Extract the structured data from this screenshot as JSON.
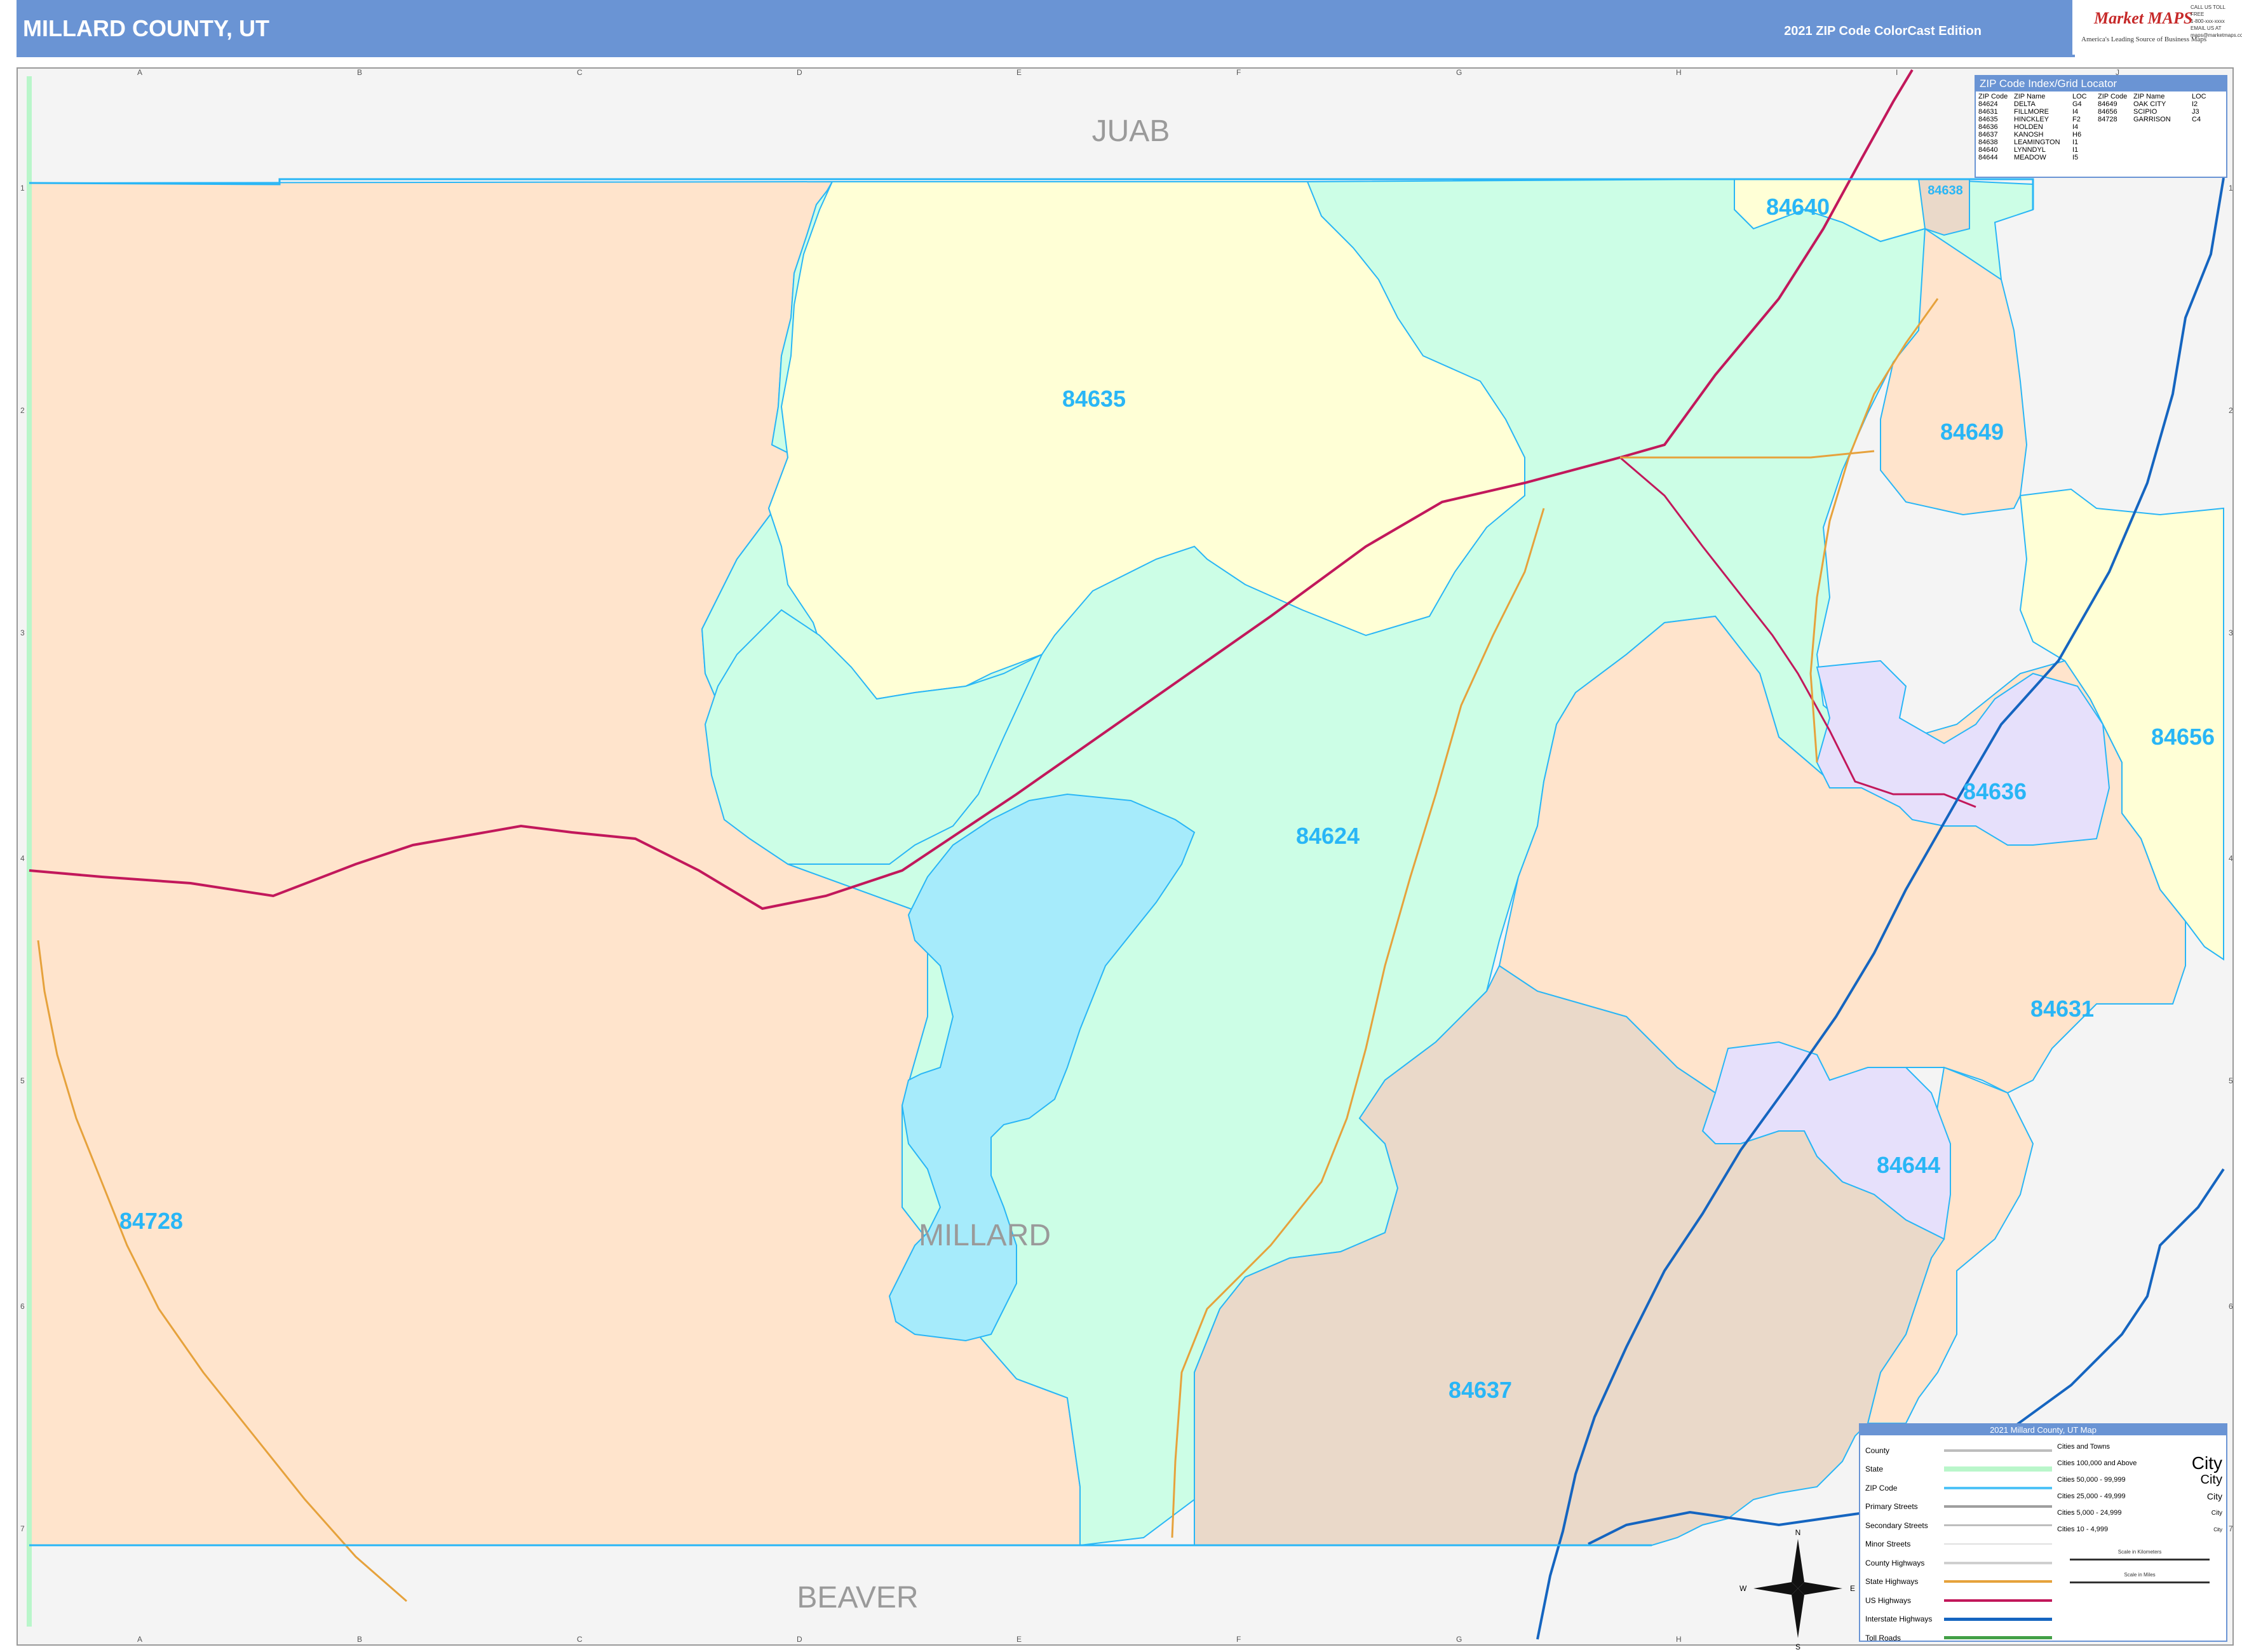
{
  "header": {
    "title": "MILLARD COUNTY, UT",
    "edition": "2021 ZIP Code ColorCast Edition"
  },
  "logo": {
    "brand": "Market MAPS",
    "tagline": "America's Leading Source of Business Maps",
    "contact": [
      "CALL US TOLL FREE",
      "1-800-xxx-xxxx",
      "EMAIL US AT",
      "maps@marketmaps.com"
    ]
  },
  "county_labels": {
    "north": "JUAB",
    "center": "MILLARD",
    "south": "BEAVER"
  },
  "zip_labels": [
    "84640",
    "84638",
    "84635",
    "84649",
    "84656",
    "84636",
    "84624",
    "84631",
    "84644",
    "84728",
    "84637"
  ],
  "grid": {
    "columns": [
      "A",
      "B",
      "C",
      "D",
      "E",
      "F",
      "G",
      "H",
      "I",
      "J"
    ],
    "rows": [
      "1",
      "2",
      "3",
      "4",
      "5",
      "6",
      "7"
    ]
  },
  "zip_index": {
    "title": "ZIP Code Index/Grid Locator",
    "headers": [
      "ZIP Code",
      "ZIP Name",
      "LOC",
      "ZIP Code",
      "ZIP Name",
      "LOC"
    ],
    "left": [
      {
        "zip": "84624",
        "name": "DELTA",
        "loc": "G4"
      },
      {
        "zip": "84631",
        "name": "FILLMORE",
        "loc": "I4"
      },
      {
        "zip": "84635",
        "name": "HINCKLEY",
        "loc": "F2"
      },
      {
        "zip": "84636",
        "name": "HOLDEN",
        "loc": "I4"
      },
      {
        "zip": "84637",
        "name": "KANOSH",
        "loc": "H6"
      },
      {
        "zip": "84638",
        "name": "LEAMINGTON",
        "loc": "I1"
      },
      {
        "zip": "84640",
        "name": "LYNNDYL",
        "loc": "I1"
      },
      {
        "zip": "84644",
        "name": "MEADOW",
        "loc": "I5"
      }
    ],
    "right": [
      {
        "zip": "84649",
        "name": "OAK CITY",
        "loc": "I2"
      },
      {
        "zip": "84656",
        "name": "SCIPIO",
        "loc": "J3"
      },
      {
        "zip": "84728",
        "name": "GARRISON",
        "loc": "C4"
      }
    ]
  },
  "legend": {
    "title": "2021 Millard County, UT Map",
    "items": [
      {
        "label": "County",
        "color": "#bdbdbd"
      },
      {
        "label": "State",
        "color": "#b9f6ca"
      },
      {
        "label": "ZIP Code",
        "color": "#4fc3f7"
      },
      {
        "label": "Primary Streets",
        "color": "#9e9e9e"
      },
      {
        "label": "Secondary Streets",
        "color": "#bdbdbd"
      },
      {
        "label": "Minor Streets",
        "color": "#e0e0e0"
      },
      {
        "label": "County Highways",
        "color": "#cfcfcf"
      },
      {
        "label": "State Highways",
        "color": "#e6a23c"
      },
      {
        "label": "US Highways",
        "color": "#c2185b"
      },
      {
        "label": "Interstate Highways",
        "color": "#1565c0"
      },
      {
        "label": "Toll Roads",
        "color": "#43a047"
      }
    ],
    "cities_title": "Cities and Towns",
    "cities": [
      {
        "range": "Cities 100,000 and Above",
        "sample": "City"
      },
      {
        "range": "Cities 50,000 - 99,999",
        "sample": "City"
      },
      {
        "range": "Cities 25,000 - 49,999",
        "sample": "City"
      },
      {
        "range": "Cities 5,000 - 24,999",
        "sample": "City"
      },
      {
        "range": "Cities 10 - 4,999",
        "sample": "City"
      }
    ],
    "scale_km": "Scale in Kilometers",
    "scale_mi": "Scale in Miles"
  },
  "compass": [
    "N",
    "E",
    "S",
    "W"
  ],
  "colors": {
    "header": "#6a94d4",
    "zip_peach": "#ffe4cc",
    "zip_yellow": "#ffffd6",
    "zip_mint": "#ccfee6",
    "zip_lavender": "#e6e0fb",
    "zip_tan": "#ead9c9",
    "lake": "#a6ebfb",
    "zip_label": "#29b6f6",
    "us_highway": "#c2185b",
    "interstate": "#1565c0",
    "state_highway": "#e6a23c"
  }
}
